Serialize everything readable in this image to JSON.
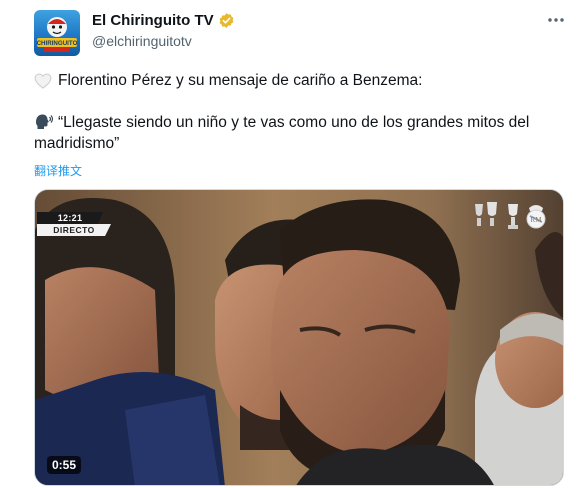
{
  "author": {
    "display_name": "El Chiringuito TV",
    "handle": "@elchiringuitotv",
    "avatar_text": "CHIRINGUITO",
    "verified_color": "#e8b92f"
  },
  "tweet": {
    "line1": "Florentino Pérez y su mensaje de cariño a Benzema:",
    "line2": "“Llegaste siendo un niño y te vas como uno de los grandes mitos del madridismo”",
    "translate_label": "翻译推文"
  },
  "media": {
    "live_time": "12:21",
    "live_label": "DIRECTO",
    "duration": "0:55"
  },
  "colors": {
    "accent": "#1d9bf0",
    "text": "#0f1419",
    "secondary": "#536471"
  }
}
